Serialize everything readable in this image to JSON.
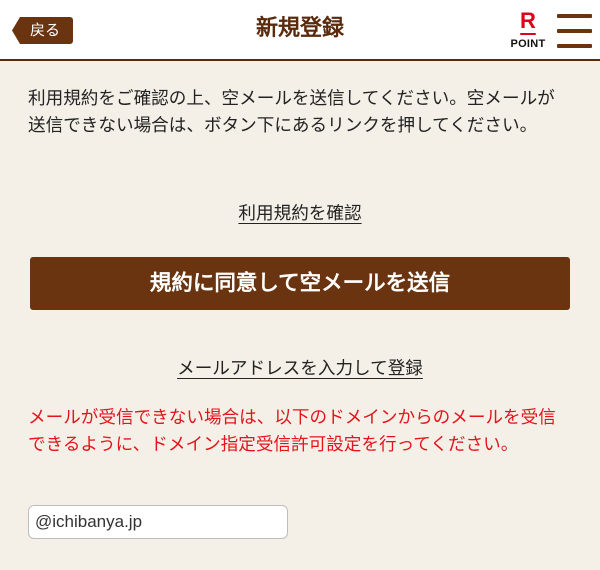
{
  "header": {
    "back_label": "戻る",
    "title": "新規登録",
    "logo": {
      "mark": "R",
      "text": "POINT"
    },
    "menu_icon": "hamburger-icon"
  },
  "main": {
    "intro": "利用規約をご確認の上、空メールを送信してください。空メールが送信できない場合は、ボタン下にあるリンクを押してください。",
    "terms_link": "利用規約を確認",
    "send_button": "規約に同意して空メールを送信",
    "register_link": "メールアドレスを入力して登録",
    "notice": "メールが受信できない場合は、以下のドメインからのメールを受信できるように、ドメイン指定受信許可設定を行ってください。",
    "domain_input": {
      "value": "@ichibanya.jp"
    }
  },
  "colors": {
    "brand_brown": "#6b3410",
    "title_brown": "#5a2a0c",
    "notice_red": "#e4141b",
    "logo_red": "#e0001a",
    "background": "#f4f0e8"
  }
}
